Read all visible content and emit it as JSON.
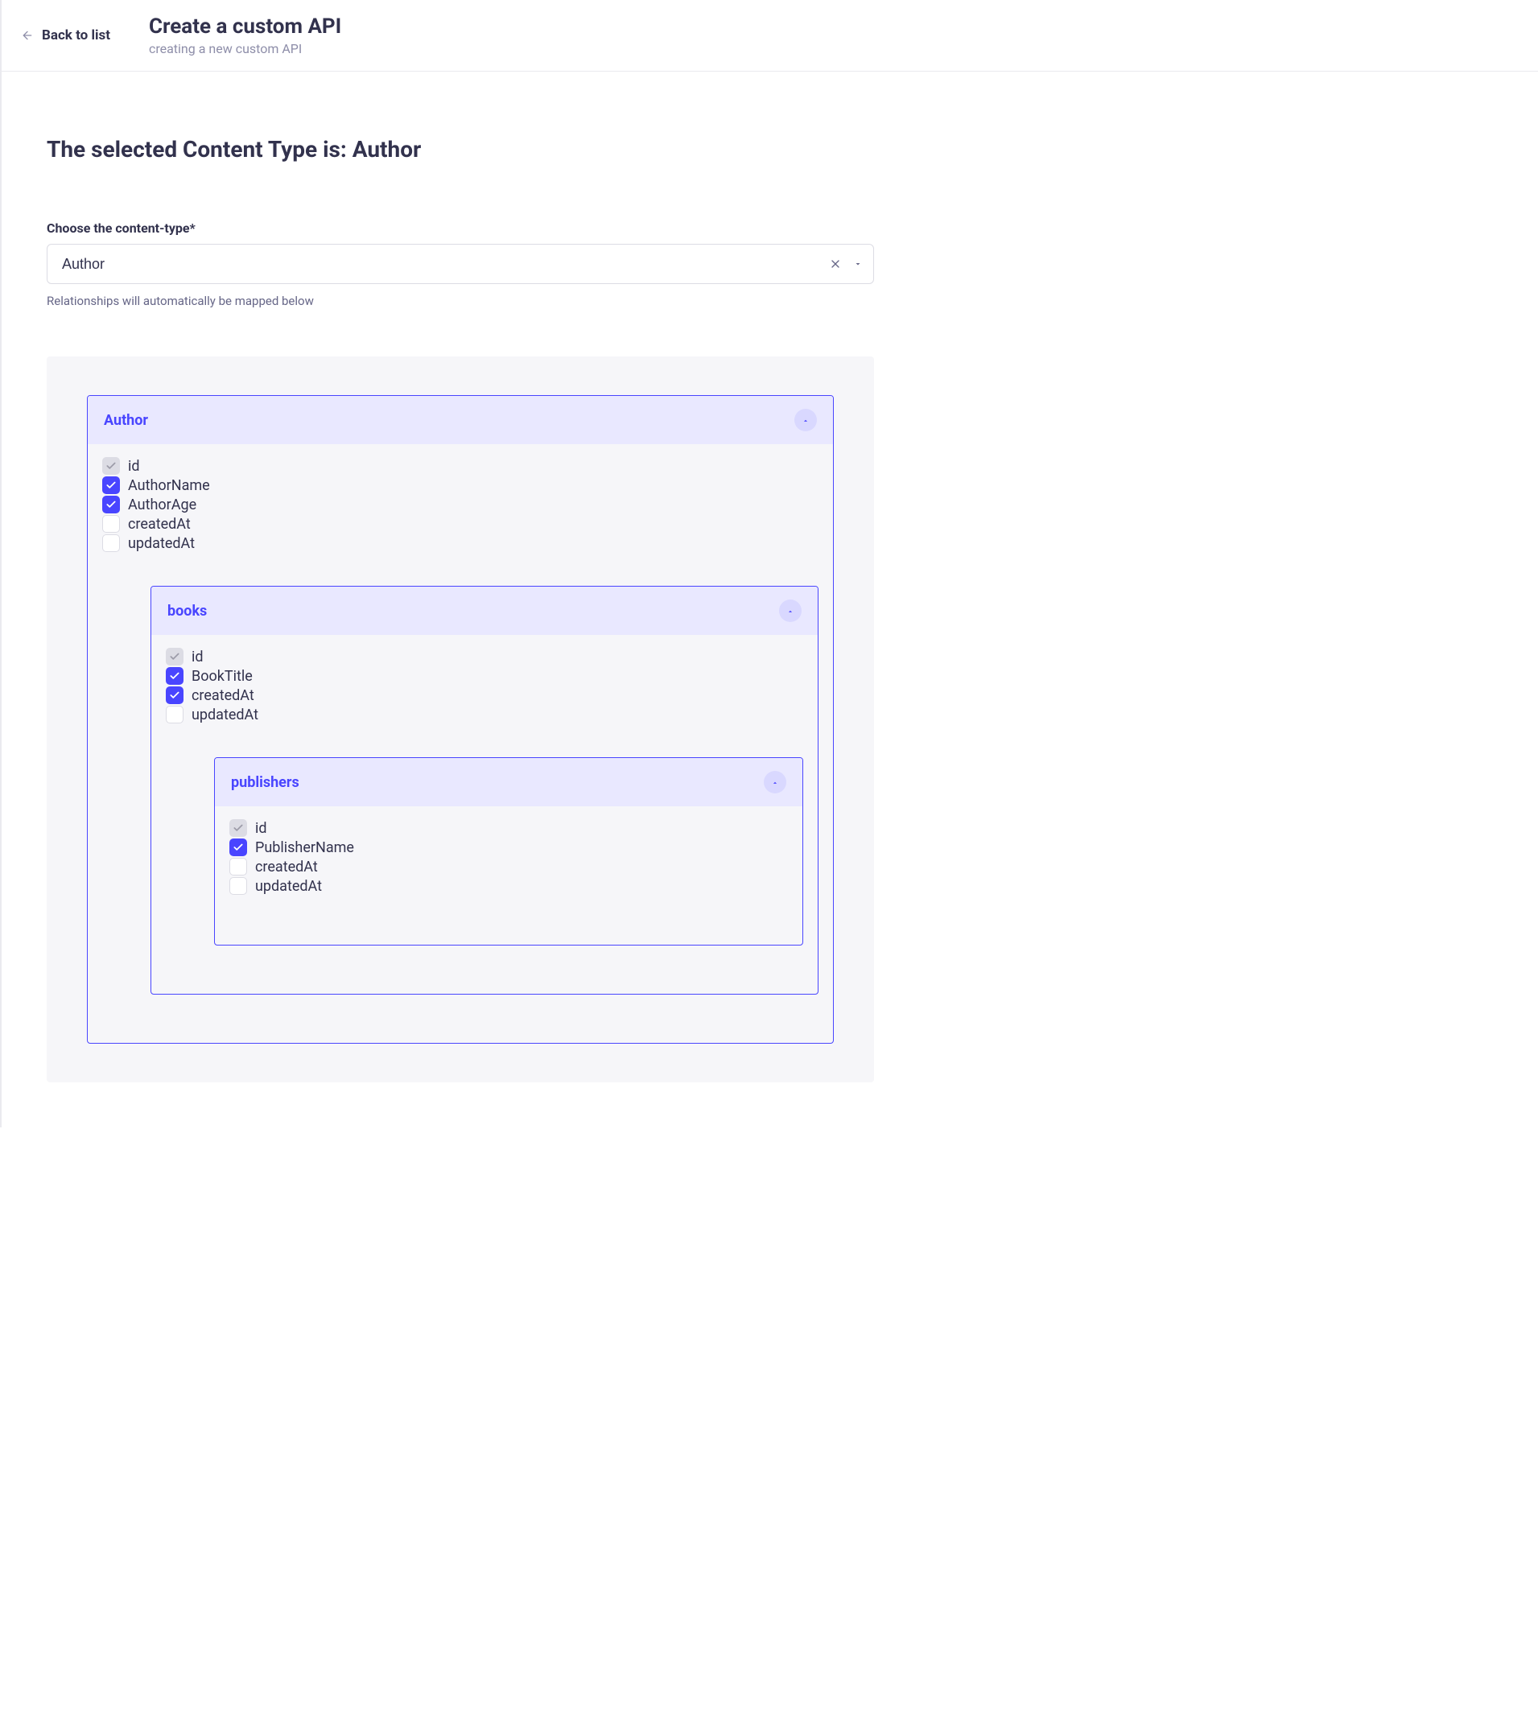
{
  "header": {
    "back_label": "Back to list",
    "title": "Create a custom API",
    "subtitle": "creating a new custom API"
  },
  "main": {
    "heading": "The selected Content Type is: Author",
    "field_label": "Choose the content-type*",
    "select_value": "Author",
    "helper_text": "Relationships will automatically be mapped below"
  },
  "tree": {
    "title": "Author",
    "fields": [
      {
        "name": "id",
        "state": "disabled"
      },
      {
        "name": "AuthorName",
        "state": "checked"
      },
      {
        "name": "AuthorAge",
        "state": "checked"
      },
      {
        "name": "createdAt",
        "state": "unchecked"
      },
      {
        "name": "updatedAt",
        "state": "unchecked"
      }
    ],
    "child": {
      "title": "books",
      "fields": [
        {
          "name": "id",
          "state": "disabled"
        },
        {
          "name": "BookTitle",
          "state": "checked"
        },
        {
          "name": "createdAt",
          "state": "checked"
        },
        {
          "name": "updatedAt",
          "state": "unchecked"
        }
      ],
      "child": {
        "title": "publishers",
        "fields": [
          {
            "name": "id",
            "state": "disabled"
          },
          {
            "name": "PublisherName",
            "state": "checked"
          },
          {
            "name": "createdAt",
            "state": "unchecked"
          },
          {
            "name": "updatedAt",
            "state": "unchecked"
          }
        ]
      }
    }
  }
}
